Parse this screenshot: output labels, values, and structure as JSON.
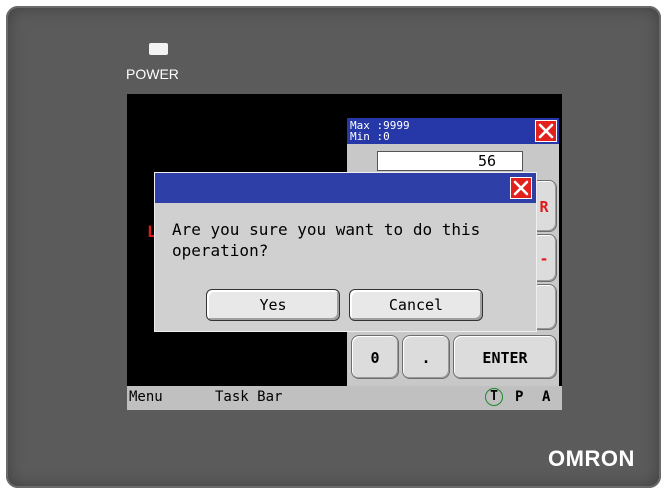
{
  "device": {
    "power_label": "POWER",
    "brand": "OMRON"
  },
  "screen": {
    "background_color": "#000000",
    "red_label": "L"
  },
  "keypad": {
    "max_label": "Max :9999",
    "min_label": "Min :0",
    "value": "56",
    "side_keys": [
      "R",
      "-",
      ""
    ],
    "keys": [
      "0",
      ".",
      "ENTER"
    ],
    "title_color": "#2638a8",
    "close_icon": "close-icon"
  },
  "dialog": {
    "message": "Are you sure you want to do this operation?",
    "yes_label": "Yes",
    "cancel_label": "Cancel",
    "title_color": "#2e3fa8",
    "close_icon": "close-icon"
  },
  "taskbar": {
    "menu_label": "Menu",
    "taskbar_label": "Task Bar",
    "t_label": "T",
    "p_label": "P",
    "a_label": "A",
    "t_ring_color": "#1c8a2b"
  }
}
